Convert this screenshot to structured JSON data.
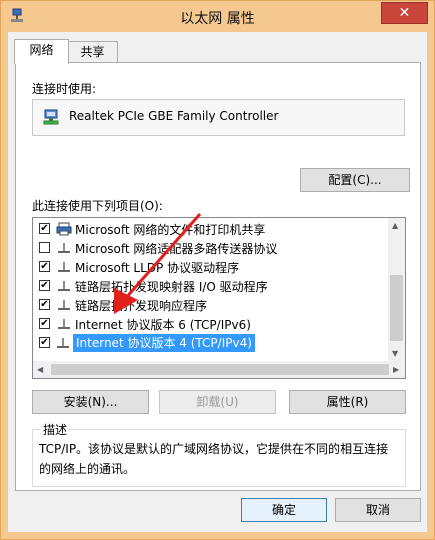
{
  "window": {
    "title": "以太网 属性",
    "close_glyph": "✕"
  },
  "tabs": [
    {
      "label": "网络"
    },
    {
      "label": "共享"
    }
  ],
  "connect_using": {
    "label": "连接时使用:",
    "adapter": "Realtek PCIe GBE Family Controller",
    "configure_button": "配置(C)..."
  },
  "items_section": {
    "label": "此连接使用下列项目(O):"
  },
  "items": [
    {
      "label": "Microsoft 网络的文件和打印机共享",
      "checked": true,
      "icon": "printer-icon"
    },
    {
      "label": "Microsoft 网络适配器多路传送器协议",
      "checked": false,
      "icon": "network-protocol-icon"
    },
    {
      "label": "Microsoft LLDP 协议驱动程序",
      "checked": true,
      "icon": "network-protocol-icon"
    },
    {
      "label": "链路层拓扑发现映射器 I/O 驱动程序",
      "checked": true,
      "icon": "network-protocol-icon"
    },
    {
      "label": "链路层拓扑发现响应程序",
      "checked": true,
      "icon": "network-protocol-icon"
    },
    {
      "label": "Internet 协议版本 6 (TCP/IPv6)",
      "checked": true,
      "icon": "network-protocol-icon"
    },
    {
      "label": "Internet 协议版本 4 (TCP/IPv4)",
      "checked": true,
      "icon": "network-protocol-icon",
      "selected": true
    }
  ],
  "actions": {
    "install": "安装(N)...",
    "uninstall": "卸载(U)",
    "properties": "属性(R)"
  },
  "description": {
    "title": "描述",
    "text": "TCP/IP。该协议是默认的广域网络协议，它提供在不同的相互连接的网络上的通讯。"
  },
  "footer": {
    "ok": "确定",
    "cancel": "取消"
  },
  "colors": {
    "selection": "#3399ff",
    "title_bar": "#f5c890",
    "close_button": "#c9463d",
    "annotation_arrow": "#e0201a"
  }
}
